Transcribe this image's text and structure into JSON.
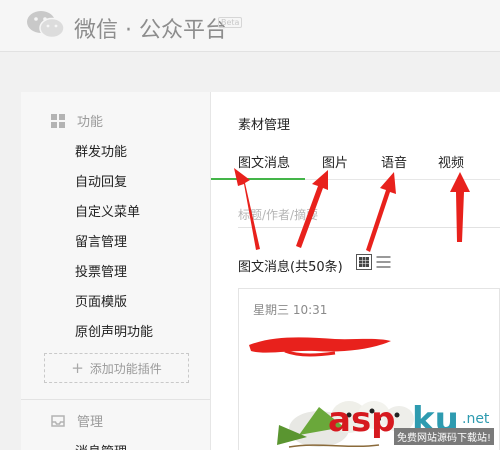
{
  "header": {
    "brand": "微信 · 公众平台",
    "beta_label": "Beta"
  },
  "sidebar": {
    "feature_section": {
      "label": "功能",
      "icon": "grid-icon"
    },
    "items": [
      {
        "label": "群发功能"
      },
      {
        "label": "自动回复"
      },
      {
        "label": "自定义菜单"
      },
      {
        "label": "留言管理"
      },
      {
        "label": "投票管理"
      },
      {
        "label": "页面模版"
      },
      {
        "label": "原创声明功能"
      }
    ],
    "add_plugin": {
      "label": "添加功能插件",
      "icon": "plus-icon"
    },
    "manage_section": {
      "label": "管理",
      "icon": "inbox-icon"
    },
    "manage_first_item": "消息管理"
  },
  "main": {
    "title": "素材管理",
    "tabs": [
      {
        "label": "图文消息",
        "active": true
      },
      {
        "label": "图片",
        "active": false
      },
      {
        "label": "语音",
        "active": false
      },
      {
        "label": "视频",
        "active": false
      }
    ],
    "search_placeholder": "标题/作者/摘要",
    "count_label": "图文消息(共50条)",
    "view_icons": [
      "grid-view-icon",
      "list-view-icon"
    ],
    "card": {
      "date": "星期三 10:31"
    }
  },
  "colors": {
    "accent_green": "#44b549",
    "annotation_red": "#e8211c",
    "watermark_red": "#d6191f",
    "watermark_teal": "#2e9bb0"
  },
  "watermark": {
    "brand_part1": "asp",
    "brand_part2": "ku",
    "domain": ".net",
    "tagline": "免费网站源码下载站!"
  }
}
